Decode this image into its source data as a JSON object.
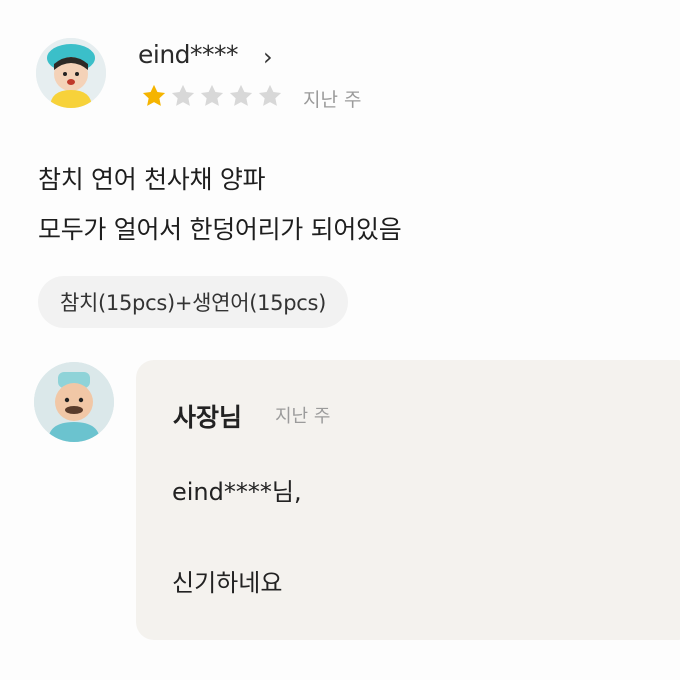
{
  "review": {
    "username": "eind****",
    "chevron": "›",
    "rating": 1,
    "max_rating": 5,
    "date": "지난 주",
    "text_line1": "참치 연어 천사채 양파",
    "text_line2": "모두가 얼어서 한덩어리가 되어있음",
    "order_option": "참치(15pcs)+생연어(15pcs)"
  },
  "reply": {
    "owner_name": "사장님",
    "date": "지난 주",
    "line1": "eind****님,",
    "line2": "신기하네요"
  },
  "colors": {
    "star_filled": "#f5b400",
    "star_empty": "#d8d8d8",
    "reply_bg": "#f4f2ee",
    "chip_bg": "#f2f2f2"
  },
  "icons": {
    "reviewer_avatar": "cartoon-girl-avatar",
    "owner_avatar": "cartoon-owner-avatar",
    "chevron": "chevron-right-icon",
    "star": "star-icon"
  }
}
